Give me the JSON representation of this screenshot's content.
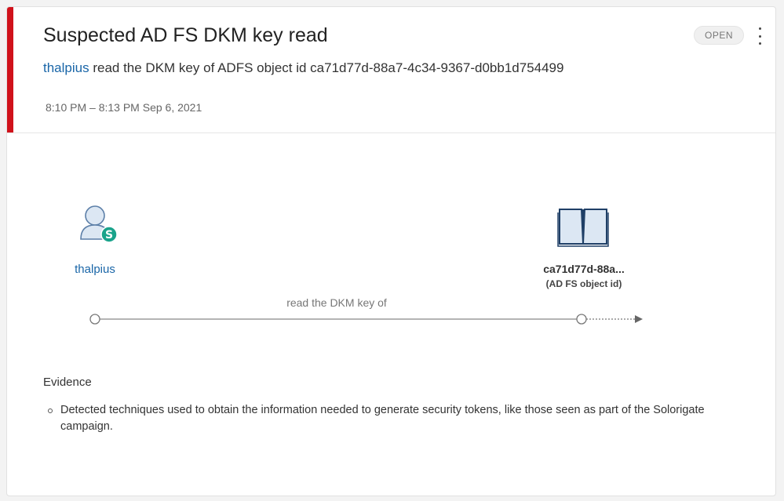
{
  "alert": {
    "title": "Suspected AD FS DKM key read",
    "status": "OPEN",
    "subtitle_user": "thalpius",
    "subtitle_text": " read the DKM key of ADFS object id ca71d77d-88a7-4c34-9367-d0bb1d754499",
    "time_range": "8:10 PM – 8:13 PM Sep 6, 2021",
    "severity_color": "#d0121b"
  },
  "graph": {
    "source": {
      "name": "thalpius",
      "icon": "user-icon",
      "badge_letter": "S",
      "badge_color": "#1aa38b"
    },
    "target": {
      "name": "ca71d77d-88a...",
      "type": "(AD FS object id)",
      "icon": "book-icon"
    },
    "edge_label": "read the DKM key of"
  },
  "evidence": {
    "heading": "Evidence",
    "items": [
      "Detected techniques used to obtain the information needed to generate security tokens, like those seen as part of the Solorigate campaign."
    ]
  }
}
